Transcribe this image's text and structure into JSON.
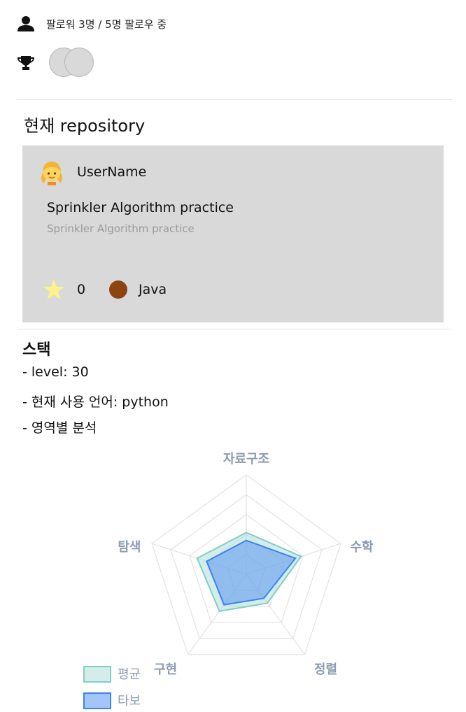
{
  "profile": {
    "follow_text": "팔로워 3명 / 5명 팔로우 중",
    "icons": {
      "user": "user-icon",
      "trophy": "trophy-icon"
    }
  },
  "current_repo": {
    "section_title": "현재 repository",
    "username": "UserName",
    "avatar_icon": "girl-emoji-avatar",
    "title": "Sprinkler Algorithm practice",
    "description": "Sprinkler Algorithm practice",
    "stars": "0",
    "language": "Java",
    "language_color": "#8b4513"
  },
  "stack": {
    "title": "스택",
    "level_line": "- level: 30",
    "language_line": "- 현재 사용 언어: python",
    "analysis_line": "- 영역별 분석"
  },
  "chart_data": {
    "type": "radar",
    "axes": [
      "자료구조",
      "수학",
      "정렬",
      "구현",
      "탐색"
    ],
    "max": 5,
    "series": [
      {
        "name": "평균",
        "values": [
          2.1,
          2.9,
          1.8,
          2.3,
          2.6
        ],
        "fill": "rgba(160,215,210,0.45)",
        "stroke": "#7fd0c4"
      },
      {
        "name": "타보",
        "values": [
          1.7,
          2.6,
          1.5,
          1.9,
          2.1
        ],
        "fill": "rgba(90,150,240,0.55)",
        "stroke": "#3b82f6"
      }
    ]
  }
}
